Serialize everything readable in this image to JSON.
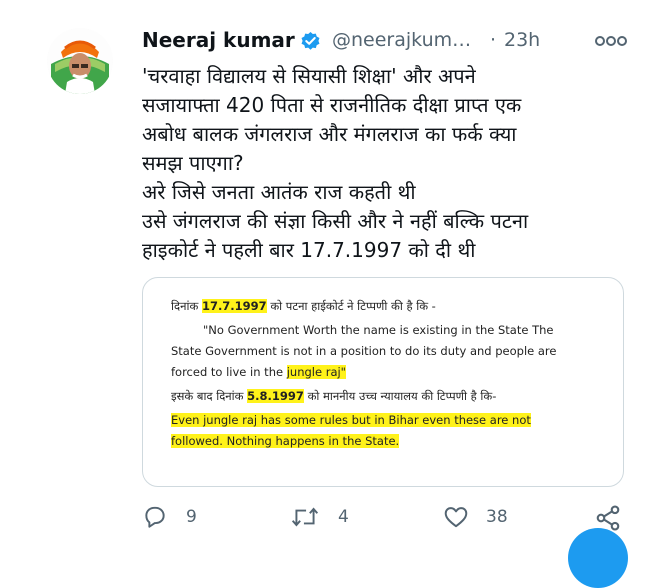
{
  "tweet": {
    "author_name": "Neeraj kumar",
    "handle": "@neerajkum…",
    "separator": "·",
    "time": "23h",
    "text_lines": [
      "'चरवाहा विद्यालय से सियासी शिक्षा' और अपने",
      "सजायाफ्ता 420 पिता से राजनीतिक दीक्षा प्राप्त एक",
      "अबोध बालक जंगलराज और मंगलराज का फर्क क्या",
      "समझ पाएगा?",
      "अरे जिसे जनता आतंक राज कहती थी",
      "उसे जंगलराज की संज्ञा किसी और ने नहीं बल्कि पटना",
      "हाइकोर्ट ने पहली बार 17.7.1997 को दी थी"
    ]
  },
  "card": {
    "line1_prefix": "दिनांक",
    "line1_date": "17.7.1997",
    "line1_suffix": "को पटना हाईकोर्ट ने टिप्पणी की है कि -",
    "quote_line1": "\"No Government Worth the name is existing in the State The",
    "quote_line2": "State Government is not in a position to do its duty and people are",
    "quote_line3_prefix": "forced to live in the",
    "quote_line3_highlight": "jungle raj\"",
    "line2_prefix": "इसके बाद दिनांक",
    "line2_date": "5.8.1997",
    "line2_suffix": "को माननीय उच्च न्यायालय की टिप्पणी है कि-",
    "final_line1": "Even jungle raj has some rules but in Bihar even these are not",
    "final_line2": "followed. Nothing happens in the State."
  },
  "actions": {
    "reply_count": "9",
    "retweet_count": "4",
    "like_count": "38",
    "icons": [
      "reply-icon",
      "retweet-icon",
      "like-icon",
      "share-icon"
    ]
  },
  "colors": {
    "accent": "#1d9bf0",
    "secondary_text": "#536471",
    "highlight": "#fff21a"
  }
}
